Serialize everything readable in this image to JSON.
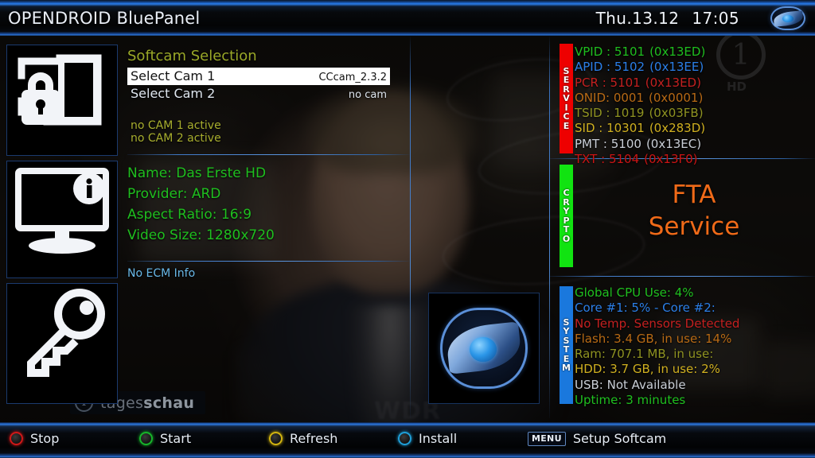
{
  "header": {
    "title": "OPENDROID BluePanel",
    "date": "Thu.13.12",
    "time": "17:05",
    "logo_icon": "eye-logo-icon"
  },
  "sidebar": {
    "items": [
      {
        "icon": "screen-lock-icon",
        "name": "security"
      },
      {
        "icon": "monitor-info-icon",
        "name": "info"
      },
      {
        "icon": "key-icon",
        "name": "key"
      }
    ]
  },
  "softcam": {
    "title": "Softcam Selection",
    "rows": [
      {
        "label": "Select Cam 1",
        "value": "CCcam_2.3.2",
        "selected": true
      },
      {
        "label": "Select Cam 2",
        "value": "no cam",
        "selected": false
      }
    ],
    "status": [
      "no CAM 1 active",
      "no CAM 2 active"
    ]
  },
  "service_info": {
    "lines": [
      "Name: Das Erste HD",
      "Provider: ARD",
      "Aspect Ratio: 16:9",
      "Video Size: 1280x720"
    ],
    "ecm": "No ECM Info"
  },
  "center_logo": {
    "icon": "eye-logo-icon"
  },
  "service_panel": {
    "tab_label": "SERVICE",
    "tab_color": "#ee0000",
    "rows": [
      {
        "key": "VPID :",
        "value": "5101",
        "hex": "(0x13ED)",
        "color": "#1fbf1f"
      },
      {
        "key": "APID :",
        "value": "5102",
        "hex": "(0x13EE)",
        "color": "#2b7fe8"
      },
      {
        "key": "PCR  :",
        "value": "5101",
        "hex": "(0x13ED)",
        "color": "#c42020"
      },
      {
        "key": "ONID:",
        "value": "0001",
        "hex": "(0x0001)",
        "color": "#b86a15"
      },
      {
        "key": "TSID :",
        "value": "1019",
        "hex": "(0x03FB)",
        "color": "#8f9321"
      },
      {
        "key": "SID  :",
        "value": "10301",
        "hex": "(0x283D)",
        "color": "#d0b020"
      },
      {
        "key": "PMT  :",
        "value": "5100",
        "hex": "(0x13EC)",
        "color": "#c9ced6"
      },
      {
        "key": "TXT  :",
        "value": "5104",
        "hex": "(0x13F0)",
        "color": "#cc1414"
      }
    ]
  },
  "crypto_panel": {
    "tab_label": "CRYPTO",
    "tab_color": "#11e311",
    "line1": "FTA",
    "line2": "Service",
    "text_color": "#f06a18"
  },
  "system_panel": {
    "tab_label": "SYSTEM",
    "tab_color": "#1a78dd",
    "rows": [
      {
        "text": "Global CPU Use:   4%",
        "color": "#1fbf1f"
      },
      {
        "text": "Core #1:   5%  -  Core #2:",
        "color": "#2b7fe8"
      },
      {
        "text": "No Temp. Sensors Detected",
        "color": "#c42020"
      },
      {
        "text": "Flash: 3.4 GB, in use: 14%",
        "color": "#b86a15"
      },
      {
        "text": "Ram: 707.1 MB, in use:",
        "color": "#8f9321"
      },
      {
        "text": "HDD: 3.7 GB, in use: 2%",
        "color": "#d0b020"
      },
      {
        "text": "USB: Not Available",
        "color": "#c9ced6"
      },
      {
        "text": "Uptime: 3 minutes",
        "color": "#1fbf1f"
      }
    ]
  },
  "buttons": [
    {
      "label": "Stop",
      "color": "#d01818",
      "key": null
    },
    {
      "label": "Start",
      "color": "#17b52a",
      "key": null
    },
    {
      "label": "Refresh",
      "color": "#d2b410",
      "key": null
    },
    {
      "label": "Install",
      "color": "#1f9fd8",
      "key": null
    },
    {
      "label": "Setup Softcam",
      "color": null,
      "key": "MENU"
    }
  ],
  "video": {
    "channel_watermark": "1",
    "channel_watermark_hd": "HD",
    "lower_third_prefix": "tages",
    "lower_third_suffix": "schau",
    "lower_third_badge": "1",
    "broadcaster_mark": "WDR"
  }
}
